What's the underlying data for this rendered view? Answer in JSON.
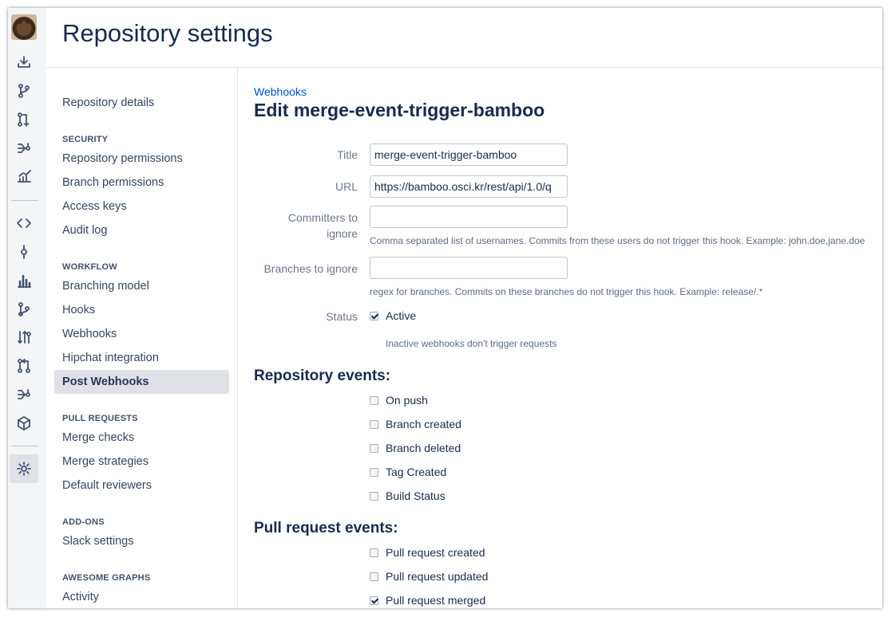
{
  "page": {
    "title": "Repository settings"
  },
  "nav": {
    "top": [
      "Repository details"
    ],
    "sections": [
      {
        "heading": "SECURITY",
        "items": [
          "Repository permissions",
          "Branch permissions",
          "Access keys",
          "Audit log"
        ]
      },
      {
        "heading": "WORKFLOW",
        "items": [
          "Branching model",
          "Hooks",
          "Webhooks",
          "Hipchat integration",
          "Post Webhooks"
        ]
      },
      {
        "heading": "PULL REQUESTS",
        "items": [
          "Merge checks",
          "Merge strategies",
          "Default reviewers"
        ]
      },
      {
        "heading": "ADD-ONS",
        "items": [
          "Slack settings"
        ]
      },
      {
        "heading": "AWESOME GRAPHS",
        "items": [
          "Activity"
        ]
      }
    ],
    "selected": "Post Webhooks"
  },
  "rail": {
    "icons": [
      "clone-icon",
      "branches-icon",
      "pull-request-create-icon",
      "fork-icon",
      "insights-icon",
      "source-icon",
      "commits-icon",
      "reports-icon",
      "branch-graph-icon",
      "compare-icon",
      "pull-requests-icon",
      "forks-icon",
      "package-icon",
      "settings-icon"
    ]
  },
  "form": {
    "breadcrumb": "Webhooks",
    "heading": "Edit merge-event-trigger-bamboo",
    "title_label": "Title",
    "title_value": "merge-event-trigger-bamboo",
    "url_label": "URL",
    "url_value": "https://bamboo.osci.kr/rest/api/1.0/q",
    "committers_label_line1": "Committers to",
    "committers_label_line2": "ignore",
    "committers_value": "",
    "committers_help": "Comma separated list of usernames. Commits from these users do not trigger this hook. Example: john.doe,jane.doe",
    "branches_label": "Branches to ignore",
    "branches_value": "",
    "branches_help": "regex for branches. Commits on these branches do not trigger this hook. Example: release/.*",
    "status_label": "Status",
    "status_checkbox_label": "Active",
    "status_checked": true,
    "status_help": "Inactive webhooks don't trigger requests"
  },
  "repository_events": {
    "title": "Repository events:",
    "items": [
      {
        "label": "On push",
        "checked": false
      },
      {
        "label": "Branch created",
        "checked": false
      },
      {
        "label": "Branch deleted",
        "checked": false
      },
      {
        "label": "Tag Created",
        "checked": false
      },
      {
        "label": "Build Status",
        "checked": false
      }
    ]
  },
  "pull_request_events": {
    "title": "Pull request events:",
    "items": [
      {
        "label": "Pull request created",
        "checked": false
      },
      {
        "label": "Pull request updated",
        "checked": false
      },
      {
        "label": "Pull request merged",
        "checked": true
      }
    ]
  }
}
